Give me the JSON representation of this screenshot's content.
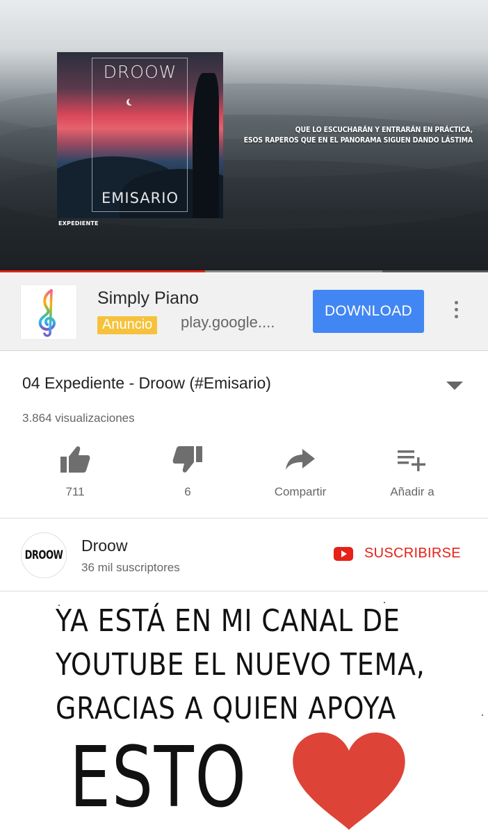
{
  "video": {
    "album_title": "DROOW",
    "album_subtitle": "EMISARIO",
    "album_label": "EXPEDIENTE",
    "lyrics_line1": "QUE LO ESCUCHARÁN Y ENTRARÁN EN PRÁCTICA,",
    "lyrics_line2": "ESOS RAPEROS QUE EN EL PANORAMA SIGUEN DANDO LÁSTIMA",
    "progress_fraction": 0.42,
    "accent_color": "#e62117"
  },
  "ad": {
    "app_name": "Simply Piano",
    "badge": "Anuncio",
    "url": "play.google....",
    "button_label": "DOWNLOAD",
    "icon": "treble-clef-icon",
    "more_icon": "more-vert-icon",
    "button_color": "#4286f4",
    "badge_color": "#f6c23c"
  },
  "video_info": {
    "title": "04 Expediente - Droow (#Emisario)",
    "views": "3.864 visualizaciones",
    "actions": [
      {
        "icon": "thumbs-up-icon",
        "label": "711"
      },
      {
        "icon": "thumbs-down-icon",
        "label": "6"
      },
      {
        "icon": "share-icon",
        "label": "Compartir"
      },
      {
        "icon": "playlist-add-icon",
        "label": "Añadir a"
      }
    ]
  },
  "channel": {
    "avatar_text": "DROOW",
    "name": "Droow",
    "subscribers": "36 mil suscriptores",
    "subscribe_label": "SUSCRIBIRSE"
  },
  "caption": {
    "line1": "YA ESTÁ EN MI CANAL DE",
    "line2": "YOUTUBE EL NUEVO TEMA,",
    "line3": "GRACIAS A QUIEN APOYA",
    "big_word": "ESTO",
    "heart_color": "#dd4437"
  }
}
